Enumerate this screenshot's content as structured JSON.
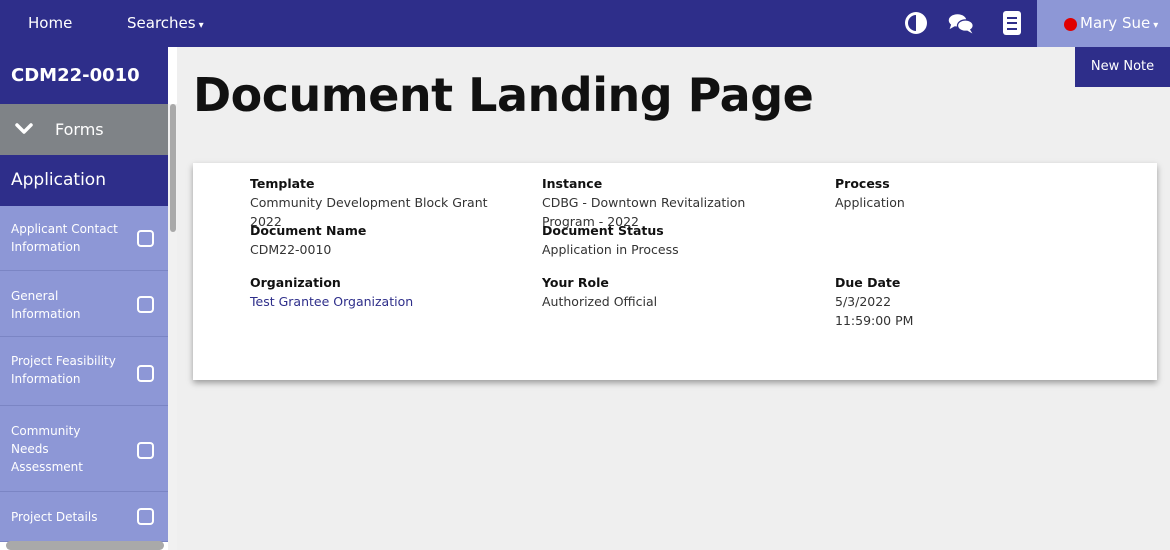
{
  "topbar": {
    "home": "Home",
    "searches": "Searches",
    "user_name": "Mary Sue",
    "user_status_color": "#e00000",
    "icons": [
      "contrast-icon",
      "chat-icon",
      "document-icon"
    ]
  },
  "sidebar": {
    "title": "CDM22-0010",
    "forms_label": "Forms",
    "section_label": "Application",
    "items": [
      {
        "label": "Applicant Contact Information"
      },
      {
        "label": "General Information"
      },
      {
        "label": "Project Feasibility Information"
      },
      {
        "label": "Community Needs Assessment"
      },
      {
        "label": "Project Details"
      }
    ]
  },
  "main": {
    "title": "Document Landing Page",
    "new_note": "New Note",
    "details": {
      "template_label": "Template",
      "template_value": "Community Development Block Grant 2022",
      "instance_label": "Instance",
      "instance_value": "CDBG - Downtown Revitalization Program - 2022",
      "process_label": "Process",
      "process_value": "Application",
      "doc_name_label": "Document Name",
      "doc_name_value": "CDM22-0010",
      "doc_status_label": "Document Status",
      "doc_status_value": "Application in Process",
      "org_label": "Organization",
      "org_value": "Test Grantee Organization",
      "role_label": "Your Role",
      "role_value": "Authorized Official",
      "due_label": "Due Date",
      "due_date": "5/3/2022",
      "due_time": "11:59:00 PM"
    }
  },
  "colors": {
    "brand": "#2e2e8a",
    "nav_light": "#8d97d6",
    "forms_bg": "#7f8387"
  }
}
